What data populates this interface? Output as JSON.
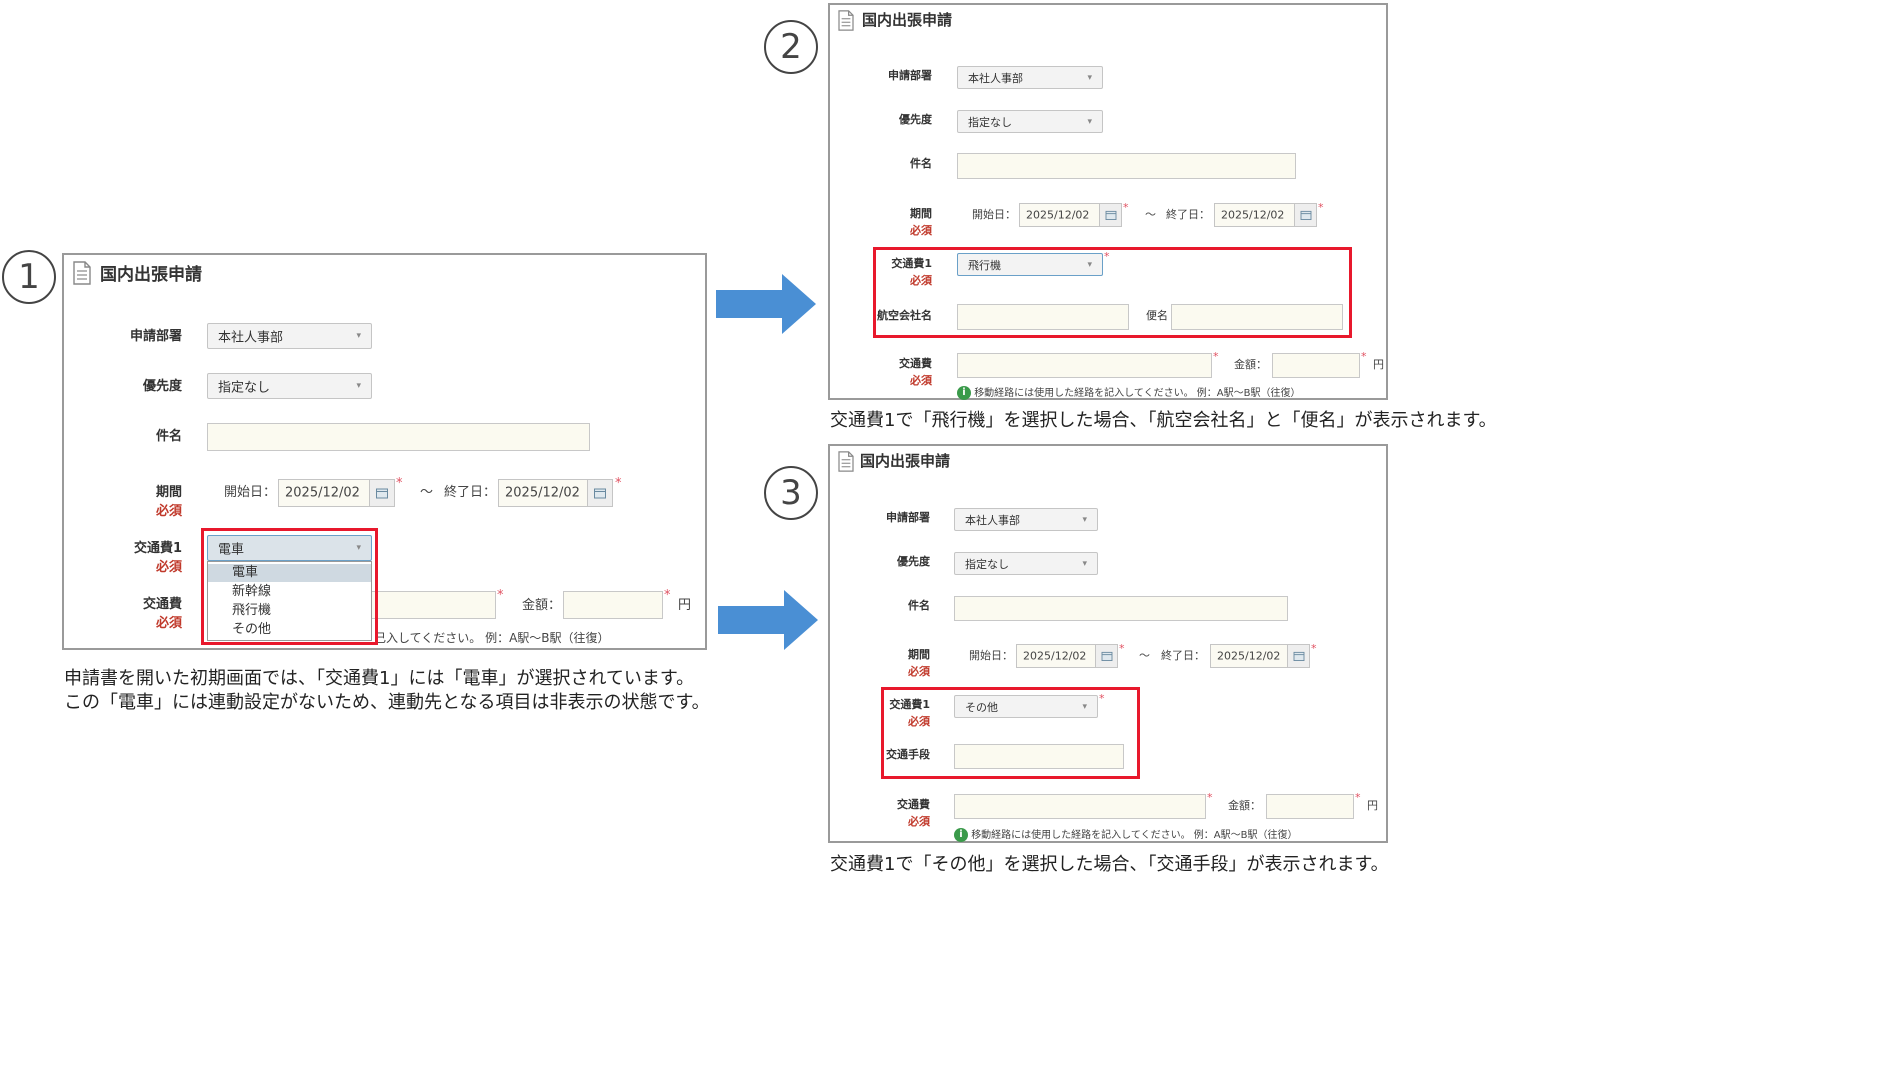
{
  "markers": {
    "p1": "1",
    "p2": "2",
    "p3": "3"
  },
  "colors": {
    "arrow": "#4a8fd4",
    "highlight": "#e8182c",
    "required": "#c0392b",
    "star": "#e05060"
  },
  "icons": [
    "document-icon",
    "calendar-icon",
    "chevron-down-icon",
    "info-icon",
    "arrow-right-icon"
  ],
  "form": {
    "title": "国内出張申請",
    "dept_label": "申請部署",
    "dept_value": "本社人事部",
    "priority_label": "優先度",
    "priority_value": "指定なし",
    "subject_label": "件名",
    "period_label": "期間",
    "required": "必須",
    "start_label": "開始日：",
    "start_value": "2025/12/02",
    "tilde": "〜",
    "end_label": "終了日：",
    "end_value": "2025/12/02",
    "fare1_label": "交通費1",
    "fare_label": "交通費",
    "amount_label": "金額：",
    "yen": "円",
    "star": "*",
    "hint": "移動経路には使用した経路を記入してください。 例：A駅〜B駅（往復）",
    "hint_partial": "己入してください。 例：A駅〜B駅（往復）",
    "airline_label": "航空会社名",
    "flight_label": "便名",
    "transport_label": "交通手段"
  },
  "panel1": {
    "fare1_value": "電車",
    "options": [
      "電車",
      "新幹線",
      "飛行機",
      "その他"
    ]
  },
  "panel2": {
    "fare1_value": "飛行機",
    "caption": "交通費1で「飛行機」を選択した場合、「航空会社名」と「便名」が表示されます。"
  },
  "panel3": {
    "fare1_value": "その他",
    "caption": "交通費1で「その他」を選択した場合、「交通手段」が表示されます。"
  },
  "caption1": {
    "line1": "申請書を開いた初期画面では、「交通費1」には「電車」が選択されています。",
    "line2": "この「電車」には連動設定がないため、連動先となる項目は非表示の状態です。"
  }
}
